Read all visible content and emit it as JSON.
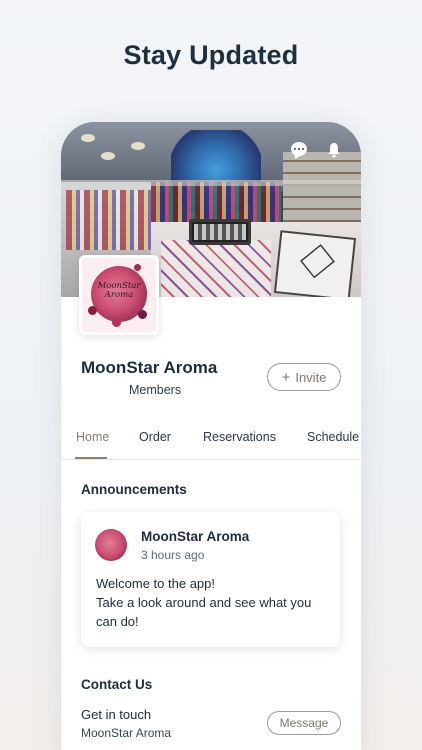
{
  "page_headline": "Stay Updated",
  "profile": {
    "name": "MoonStar Aroma",
    "members_label": "Members",
    "invite_label": "Invite",
    "logo_text_line1": "MoonStar",
    "logo_text_line2": "Aroma"
  },
  "tabs": [
    {
      "label": "Home",
      "active": true
    },
    {
      "label": "Order",
      "active": false
    },
    {
      "label": "Reservations",
      "active": false
    },
    {
      "label": "Schedule",
      "active": false
    }
  ],
  "announcements": {
    "title": "Announcements",
    "post": {
      "author": "MoonStar Aroma",
      "time": "3 hours ago",
      "body_line1": "Welcome to the app!",
      "body_line2": "Take a look around and see what you can do!"
    }
  },
  "contact": {
    "title": "Contact Us",
    "row_title": "Get in touch",
    "row_subtitle": "MoonStar Aroma",
    "message_label": "Message"
  },
  "icons": {
    "chat": "chat-bubble-icon",
    "bell": "bell-icon"
  },
  "colors": {
    "accent": "#8b8171",
    "text": "#1f2d3a"
  }
}
